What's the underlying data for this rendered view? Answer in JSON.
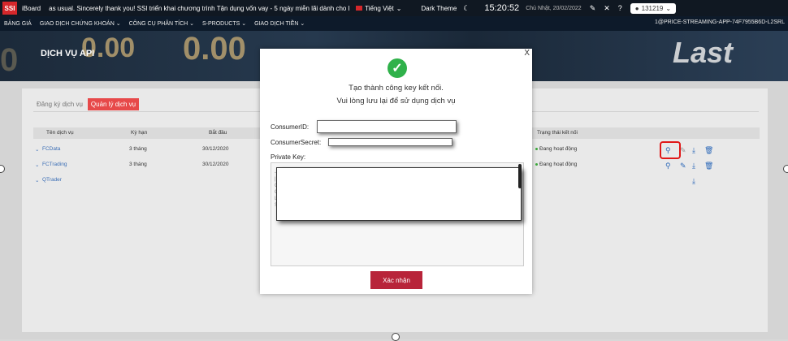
{
  "topbar": {
    "logo": "SSI",
    "app_name": "iBoard",
    "marquee": "as usual. Sincerely thank you!          SSI triển khai chương trình Tận dụng vốn vay - 5 ngày miễn lãi dành cho khách hàng đăng ký trước về",
    "language": "Tiếng Việt",
    "theme": "Dark Theme",
    "time": "15:20:52",
    "date": "Chủ Nhật, 20/02/2022",
    "user": "131219"
  },
  "nav": {
    "items": [
      "BẢNG GIÁ",
      "GIAO DỊCH CHỨNG KHOÁN ⌄",
      "CÔNG CỤ PHÂN TÍCH ⌄",
      "S-PRODUCTS ⌄",
      "GIAO DỊCH TIỀN ⌄"
    ],
    "right_text": "1@PRICE-STREAMING-APP-74F7955B6D-L2SRL"
  },
  "banner": {
    "title": "DỊCH VỤ API",
    "decor_numbers": [
      "0.00",
      "0.00",
      "Last"
    ]
  },
  "tabs": {
    "register": "Đăng ký dịch vụ",
    "manage": "Quản lý dịch vụ"
  },
  "table": {
    "headers": {
      "name": "Tên dịch vụ",
      "term": "Kỳ hạn",
      "start": "Bắt đầu",
      "status": "Trạng thái kết nối"
    },
    "rows": [
      {
        "name": "FCData",
        "term": "3 tháng",
        "start": "30/12/2020",
        "status": "Đang hoạt động"
      },
      {
        "name": "FCTrading",
        "term": "3 tháng",
        "start": "30/12/2020",
        "status": "Đang hoạt động"
      },
      {
        "name": "QTrader",
        "term": "",
        "start": "",
        "status": ""
      }
    ]
  },
  "modal": {
    "close": "X",
    "line1": "Tạo thành công key kết nối.",
    "line2": "Vui lòng lưu lại để sử dụng dịch vụ",
    "consumer_id_label": "ConsumerID:",
    "consumer_secret_label": "ConsumerSecret:",
    "private_key_label": "Private Key:",
    "confirm": "Xác nhận"
  },
  "colors": {
    "accent": "#e7494a",
    "confirm": "#b8243a",
    "success": "#2fb14a",
    "link": "#2c68b8"
  }
}
